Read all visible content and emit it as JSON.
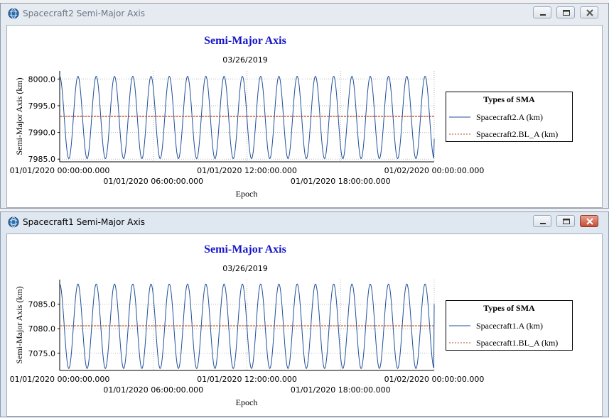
{
  "windows": [
    {
      "id": "spacecraft2",
      "state": "inactive",
      "title": "Spacecraft2 Semi-Major Axis",
      "buttons": [
        "minimize",
        "maximize",
        "close"
      ],
      "chart_data": {
        "type": "line",
        "title": "Semi-Major Axis",
        "subtitle": "03/26/2019",
        "xlabel": "Epoch",
        "ylabel": "Semi-Major Axis (km)",
        "title_color": "#1515c8",
        "x_range_hours": [
          0,
          24
        ],
        "ylim": [
          7984.5,
          8001.5
        ],
        "y_ticks": [
          "8000.0",
          "7995.0",
          "7990.0",
          "7985.0"
        ],
        "y_tick_values": [
          8000,
          7995,
          7990,
          7985
        ],
        "x_ticks_row1": [
          "01/01/2020 00:00:00.000",
          "01/01/2020 12:00:00.000",
          "01/02/2020 00:00:00.000"
        ],
        "x_ticks_row2": [
          "01/01/2020 06:00:00.000",
          "01/01/2020 18:00:00.000"
        ],
        "grid": true,
        "legend": {
          "title": "Types of SMA",
          "placement": "right",
          "entries": [
            "Spacecraft2.A (km)",
            "Spacecraft2.BL_A (km)"
          ]
        },
        "series": [
          {
            "name": "Spacecraft2.A (km)",
            "style": "solid",
            "color": "#1f4f9a",
            "oscillation": {
              "mean": 7992.8,
              "amplitude": 7.7,
              "cycles": 20.5,
              "end_value": 7988.8
            }
          },
          {
            "name": "Spacecraft2.BL_A (km)",
            "style": "dashed",
            "color": "#b5491c",
            "constant": 7993.0
          }
        ]
      }
    },
    {
      "id": "spacecraft1",
      "state": "active",
      "title": "Spacecraft1 Semi-Major Axis",
      "buttons": [
        "minimize",
        "maximize",
        "close"
      ],
      "chart_data": {
        "type": "line",
        "title": "Semi-Major Axis",
        "subtitle": "03/26/2019",
        "xlabel": "Epoch",
        "ylabel": "Semi-Major Axis (km)",
        "title_color": "#1515c8",
        "x_range_hours": [
          0,
          24
        ],
        "ylim": [
          7071.5,
          7090.0
        ],
        "y_ticks": [
          "7085.0",
          "7080.0",
          "7075.0"
        ],
        "y_tick_values": [
          7085,
          7080,
          7075
        ],
        "x_ticks_row1": [
          "01/01/2020 00:00:00.000",
          "01/01/2020 12:00:00.000",
          "01/02/2020 00:00:00.000"
        ],
        "x_ticks_row2": [
          "01/01/2020 06:00:00.000",
          "01/01/2020 18:00:00.000"
        ],
        "grid": true,
        "legend": {
          "title": "Types of SMA",
          "placement": "right",
          "entries": [
            "Spacecraft1.A (km)",
            "Spacecraft1.BL_A (km)"
          ]
        },
        "series": [
          {
            "name": "Spacecraft1.A (km)",
            "style": "solid",
            "color": "#1f4f9a",
            "oscillation": {
              "mean": 7080.5,
              "amplitude": 8.6,
              "cycles": 20.5,
              "end_value": 7085.0
            }
          },
          {
            "name": "Spacecraft1.BL_A (km)",
            "style": "dashed",
            "color": "#b5491c",
            "constant": 7080.6
          }
        ]
      }
    }
  ]
}
